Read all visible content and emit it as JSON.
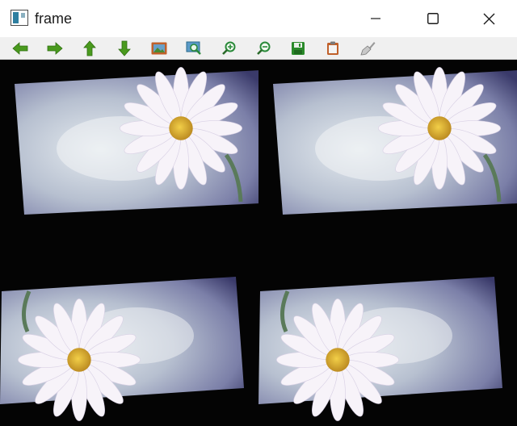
{
  "window": {
    "title": "frame",
    "controls": {
      "minimize": "minimize",
      "maximize": "maximize",
      "close": "close"
    }
  },
  "toolbar": {
    "buttons": [
      {
        "name": "pan-left",
        "icon": "arrow-left-icon",
        "color": "#4a9a1e"
      },
      {
        "name": "pan-right",
        "icon": "arrow-right-icon",
        "color": "#4a9a1e"
      },
      {
        "name": "pan-up",
        "icon": "arrow-up-icon",
        "color": "#4a9a1e"
      },
      {
        "name": "pan-down",
        "icon": "arrow-down-icon",
        "color": "#4a9a1e"
      },
      {
        "name": "zoom-original",
        "icon": "picture-icon",
        "color": "#c0602a"
      },
      {
        "name": "zoom-fit",
        "icon": "zoom-fit-icon",
        "color": "#2a8a3a"
      },
      {
        "name": "zoom-in",
        "icon": "zoom-in-icon",
        "color": "#2a8a3a"
      },
      {
        "name": "zoom-out",
        "icon": "zoom-out-icon",
        "color": "#2a8a3a"
      },
      {
        "name": "save",
        "icon": "save-icon",
        "color": "#2a8a2a"
      },
      {
        "name": "copy",
        "icon": "clipboard-icon",
        "color": "#c0602a"
      },
      {
        "name": "properties",
        "icon": "brush-icon",
        "color": "#888888"
      }
    ]
  },
  "image": {
    "description_colors": {
      "background": "#040404",
      "photo": "#b8bfd0",
      "petal": "#f6f2f8",
      "center": "#e0b030"
    },
    "tiles": 4
  }
}
